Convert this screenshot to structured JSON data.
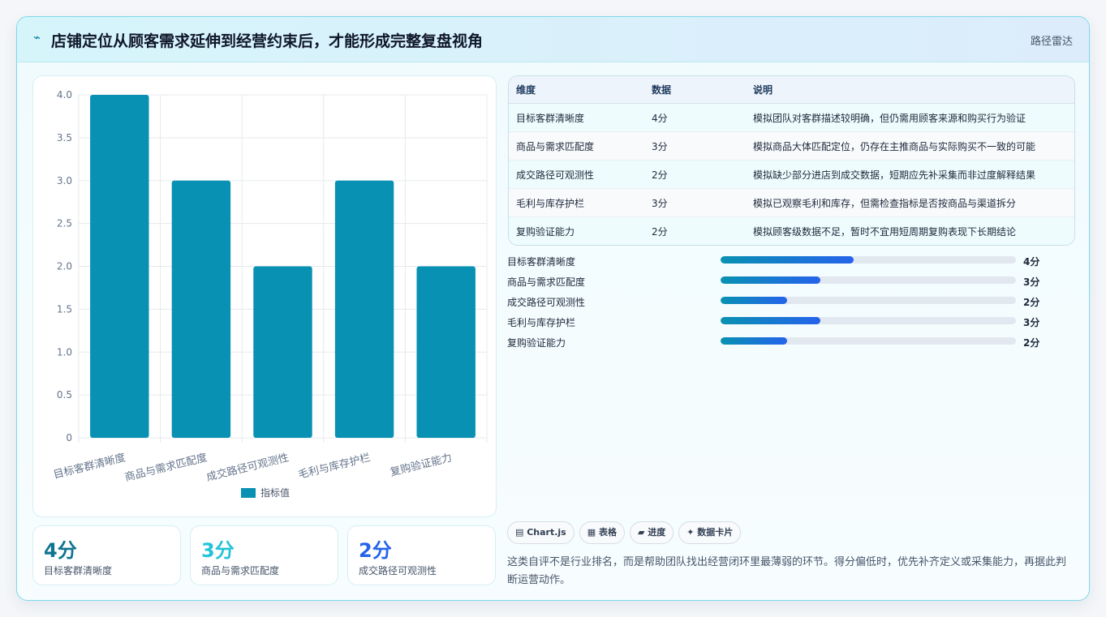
{
  "header": {
    "icon": "bolt-icon",
    "title": "店铺定位从顾客需求延伸到经营约束后，才能形成完整复盘视角",
    "tag": "路径雷达"
  },
  "chart_data": {
    "type": "bar",
    "categories": [
      "目标客群清晰度",
      "商品与需求匹配度",
      "成交路径可观测性",
      "毛利与库存护栏",
      "复购验证能力"
    ],
    "series": [
      {
        "name": "指标值",
        "values": [
          4,
          3,
          2,
          3,
          2
        ],
        "color": "#0891b2"
      }
    ],
    "ylim": [
      0,
      4
    ],
    "yticks": [
      "0",
      "0.5",
      "1.0",
      "1.5",
      "2.0",
      "2.5",
      "3.0",
      "3.5",
      "4.0"
    ],
    "grid": true,
    "legend": "bottom"
  },
  "stats": [
    {
      "value": "4分",
      "label": "目标客群清晰度",
      "color": "#0e7490"
    },
    {
      "value": "3分",
      "label": "商品与需求匹配度",
      "color": "#22c3d8"
    },
    {
      "value": "2分",
      "label": "成交路径可观测性",
      "color": "#2563eb"
    }
  ],
  "table": {
    "headers": [
      "维度",
      "数据",
      "说明"
    ],
    "rows": [
      [
        "目标客群清晰度",
        "4分",
        "模拟团队对客群描述较明确，但仍需用顾客来源和购买行为验证"
      ],
      [
        "商品与需求匹配度",
        "3分",
        "模拟商品大体匹配定位，仍存在主推商品与实际购买不一致的可能"
      ],
      [
        "成交路径可观测性",
        "2分",
        "模拟缺少部分进店到成交数据，短期应先补采集而非过度解释结果"
      ],
      [
        "毛利与库存护栏",
        "3分",
        "模拟已观察毛利和库存，但需检查指标是否按商品与渠道拆分"
      ],
      [
        "复购验证能力",
        "2分",
        "模拟顾客级数据不足，暂时不宜用短周期复购表现下长期结论"
      ]
    ]
  },
  "progress": {
    "max": 8.9,
    "items": [
      {
        "label": "目标客群清晰度",
        "value": 4,
        "text": "4分"
      },
      {
        "label": "商品与需求匹配度",
        "value": 3,
        "text": "3分"
      },
      {
        "label": "成交路径可观测性",
        "value": 2,
        "text": "2分"
      },
      {
        "label": "毛利与库存护栏",
        "value": 3,
        "text": "3分"
      },
      {
        "label": "复购验证能力",
        "value": 2,
        "text": "2分"
      }
    ]
  },
  "chips": [
    "▤ Chart.js",
    "▦ 表格",
    "▰ 进度",
    "✦ 数据卡片"
  ],
  "note": "这类自评不是行业排名，而是帮助团队找出经营闭环里最薄弱的环节。得分偏低时，优先补齐定义或采集能力，再据此判断运营动作。"
}
